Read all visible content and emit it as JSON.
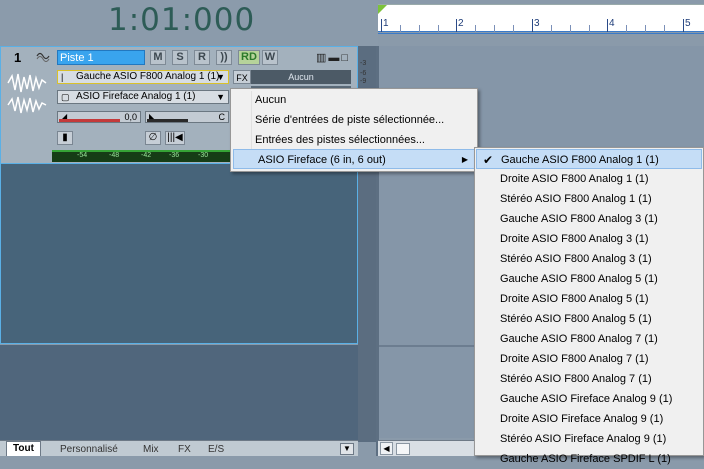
{
  "transport": {
    "time": "1:01:000"
  },
  "ruler": {
    "markers": [
      "1",
      "2",
      "3",
      "4",
      "5"
    ]
  },
  "track": {
    "number": "1",
    "name": "Piste 1",
    "buttons": {
      "mute": "M",
      "solo": "S",
      "record": "R",
      "echo": "))",
      "read": "RD",
      "write": "W"
    },
    "input": "Gauche ASIO F800 Analog 1 (1)",
    "output": "ASIO Fireface Analog 1 (1)",
    "fx_label": "FX",
    "fx_value": "Aucun",
    "volume": {
      "value": "0,0",
      "level": 0.74
    },
    "pan": {
      "value": "C",
      "level": 0.5
    },
    "side_db": [
      "-3",
      "-6",
      "-9"
    ],
    "meter_scale": [
      "-54",
      "-48",
      "-42",
      "-36",
      "-30"
    ]
  },
  "tabs": [
    {
      "label": "Tout",
      "active": true
    },
    {
      "label": "Personnalisé",
      "active": false
    },
    {
      "label": "Mix",
      "active": false
    },
    {
      "label": "FX",
      "active": false
    },
    {
      "label": "E/S",
      "active": false
    }
  ],
  "input_menu": {
    "items": [
      {
        "label": "Aucun"
      },
      {
        "label": "Série d'entrées de piste sélectionnée..."
      },
      {
        "label": "Entrées des pistes sélectionnées..."
      },
      {
        "label": "ASIO Fireface (6 in, 6 out)",
        "has_submenu": true,
        "highlighted": true
      }
    ]
  },
  "device_submenu": {
    "items": [
      {
        "label": "Gauche ASIO F800 Analog 1 (1)",
        "checked": true,
        "highlighted": true
      },
      {
        "label": "Droite ASIO F800 Analog 1 (1)"
      },
      {
        "label": "Stéréo ASIO F800 Analog 1 (1)"
      },
      {
        "label": "Gauche ASIO F800 Analog 3 (1)"
      },
      {
        "label": "Droite ASIO F800 Analog 3 (1)"
      },
      {
        "label": "Stéréo ASIO F800 Analog 3 (1)"
      },
      {
        "label": "Gauche ASIO F800 Analog 5 (1)"
      },
      {
        "label": "Droite ASIO F800 Analog 5 (1)"
      },
      {
        "label": "Stéréo ASIO F800 Analog 5 (1)"
      },
      {
        "label": "Gauche ASIO F800 Analog 7 (1)"
      },
      {
        "label": "Droite ASIO F800 Analog 7 (1)"
      },
      {
        "label": "Stéréo ASIO F800 Analog 7 (1)"
      },
      {
        "label": "Gauche ASIO Fireface Analog 9 (1)"
      },
      {
        "label": "Droite ASIO Fireface Analog 9 (1)"
      },
      {
        "label": "Stéréo ASIO Fireface Analog 9 (1)"
      },
      {
        "label": "Gauche ASIO Fireface SPDIF L (1)"
      }
    ]
  }
}
